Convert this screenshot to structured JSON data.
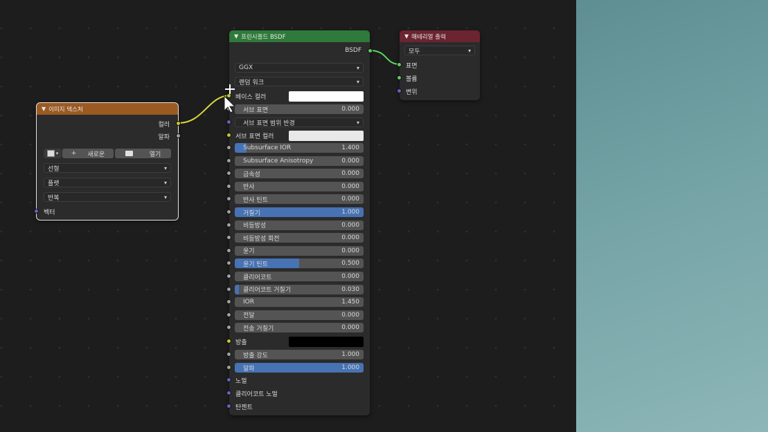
{
  "image_texture": {
    "title": "이미지 텍스처",
    "header_color": "#9b5a22",
    "outputs": [
      "컬러",
      "알파"
    ],
    "new_label": "새로운",
    "open_label": "열기",
    "interpolation": "선형",
    "projection": "플랫",
    "extension": "반복",
    "vector_label": "벡터"
  },
  "bsdf": {
    "title": "프린시플드 BSDF",
    "header_color": "#2f7a3a",
    "output": "BSDF",
    "distribution": "GGX",
    "subsurface_method": "랜덤 워크",
    "base_color_label": "베이스 컬러",
    "subsurface": {
      "label": "서브 표면",
      "value": "0.000"
    },
    "subsurface_radius": "서브 표면 범위 반경",
    "subsurface_color_label": "서브 표면 컬러",
    "sliders": [
      {
        "label": "Subsurface IOR",
        "value": "1.400",
        "fill": 0.09
      },
      {
        "label": "Subsurface Anisotropy",
        "value": "0.000",
        "fill": 0
      },
      {
        "label": "금속성",
        "value": "0.000",
        "fill": 0
      },
      {
        "label": "반사",
        "value": "0.000",
        "fill": 0
      },
      {
        "label": "반사 틴트",
        "value": "0.000",
        "fill": 0
      },
      {
        "label": "거칠기",
        "value": "1.000",
        "fill": 1.0
      },
      {
        "label": "비등방성",
        "value": "0.000",
        "fill": 0
      },
      {
        "label": "비등방성 회전",
        "value": "0.000",
        "fill": 0
      },
      {
        "label": "윤기",
        "value": "0.000",
        "fill": 0
      },
      {
        "label": "윤기 틴트",
        "value": "0.500",
        "fill": 0.5
      },
      {
        "label": "클리어코트",
        "value": "0.000",
        "fill": 0
      },
      {
        "label": "클리어코트 거칠기",
        "value": "0.030",
        "fill": 0.03
      },
      {
        "label": "IOR",
        "value": "1.450",
        "fill": 0
      },
      {
        "label": "전달",
        "value": "0.000",
        "fill": 0
      },
      {
        "label": "전송 거칠기",
        "value": "0.000",
        "fill": 0
      }
    ],
    "emission_label": "방출",
    "emission_strength": {
      "label": "방출 강도",
      "value": "1.000"
    },
    "alpha": {
      "label": "알파",
      "value": "1.000",
      "fill": 1.0
    },
    "normal_label": "노멀",
    "clearcoat_normal_label": "클리어코트 노멀",
    "tangent_label": "탄젠트"
  },
  "material_output": {
    "title": "매테리얼 출력",
    "header_color": "#6b2430",
    "target": "모두",
    "inputs": [
      "표면",
      "볼륨",
      "변위"
    ]
  },
  "colors": {
    "socket_color": "#c7c729",
    "socket_shader": "#63c763",
    "socket_vector": "#6363c7",
    "socket_float": "#a1a1a1",
    "slider_fill": "#4772b3"
  }
}
